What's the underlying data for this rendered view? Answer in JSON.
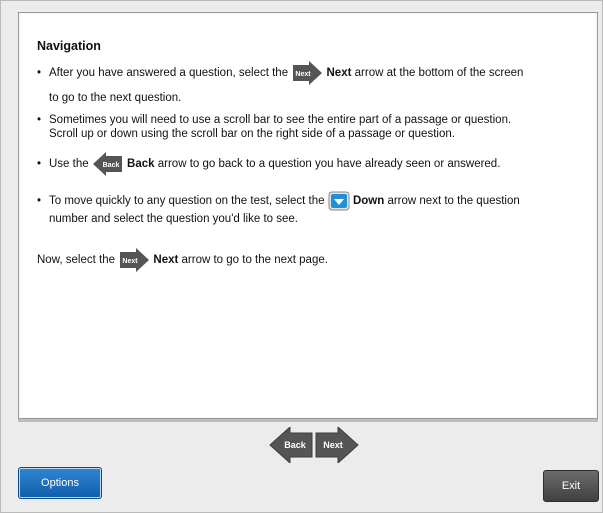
{
  "instructions": {
    "heading": "Navigation",
    "b1_pre": "After you have answered a question, select the",
    "b1_bold": "Next",
    "b1_post": "arrow at the bottom of the screen",
    "b1_line2": "to go to the next question.",
    "b2_line1": "Sometimes you will need to use a scroll bar to see the entire part of a passage or question.",
    "b2_line2": "Scroll up or down using the scroll bar on the right side of a passage or question.",
    "b3_pre": "Use the",
    "b3_bold": "Back",
    "b3_post": "arrow to go back to a question you have already seen or answered.",
    "b4_pre": "To move quickly to any question on the test, select the",
    "b4_bold": "Down",
    "b4_post": "arrow next to the question",
    "b4_line2": "number and select the question you'd like to see.",
    "final_pre": "Now, select the",
    "final_bold": "Next",
    "final_post": "arrow to go to the next page.",
    "icon_next_label": "Next",
    "icon_back_label": "Back"
  },
  "nav": {
    "back_label": "Back",
    "next_label": "Next"
  },
  "footer": {
    "options_label": "Options",
    "exit_label": "Exit"
  },
  "colors": {
    "arrow": "#555555",
    "options_blue": "#1a6fbf",
    "exit_gray": "#555555",
    "down_icon_blue": "#1f8fd8"
  },
  "icons": [
    "next-arrow-icon",
    "back-arrow-icon",
    "down-arrow-icon"
  ]
}
